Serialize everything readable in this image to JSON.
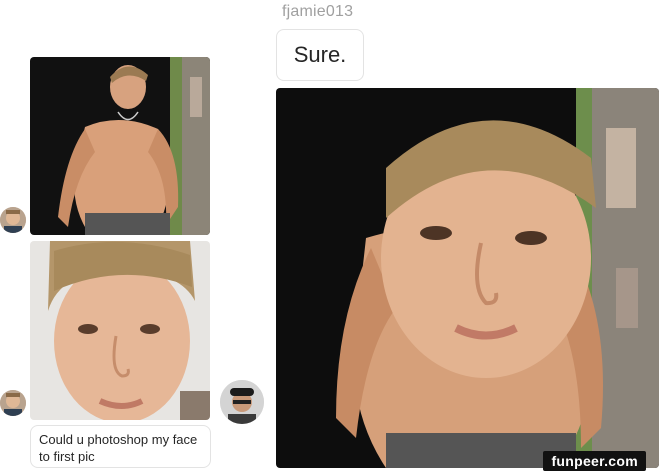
{
  "chat": {
    "username": "fjamie013",
    "reply_text": "Sure.",
    "request_text": "Could u photoshop my face to first pic"
  },
  "watermark": "funpeer.com",
  "photos": [
    {
      "description_icon": "shirtless-man-photo",
      "position": "left-top"
    },
    {
      "description_icon": "face-closeup-photo",
      "position": "left-bottom"
    },
    {
      "description_icon": "edited-photo",
      "position": "right"
    }
  ],
  "colors": {
    "background": "#ffffff",
    "username": "#a0a0a0",
    "bubble_border": "#e3e3e3",
    "text": "#262626"
  }
}
